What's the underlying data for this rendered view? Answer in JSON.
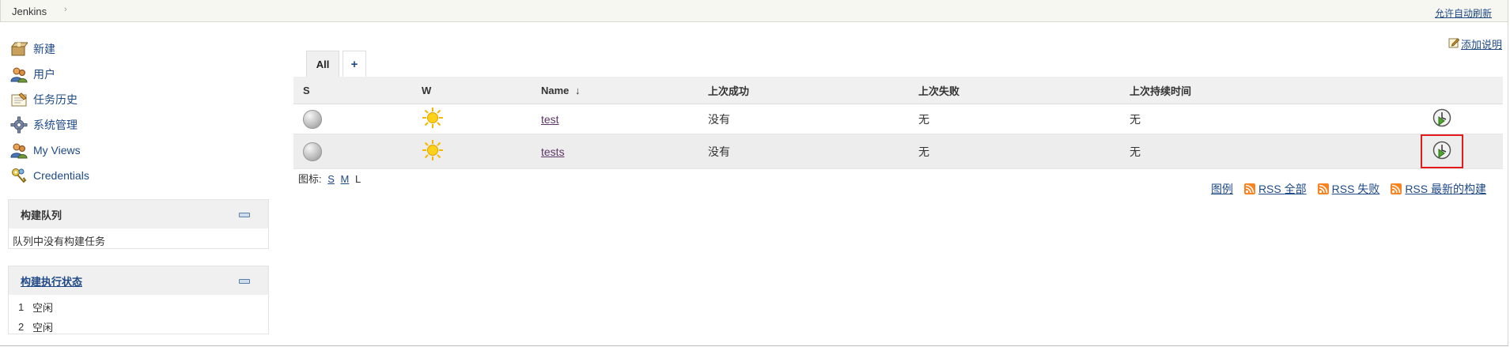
{
  "breadcrumb": {
    "root": "Jenkins",
    "separator": "›",
    "autorefresh": "允许自动刷新"
  },
  "tasks": [
    {
      "label": "新建",
      "icon": "new-item-icon"
    },
    {
      "label": "用户",
      "icon": "people-icon"
    },
    {
      "label": "任务历史",
      "icon": "notepad-icon"
    },
    {
      "label": "系统管理",
      "icon": "gear-icon"
    },
    {
      "label": "My Views",
      "icon": "people-icon"
    },
    {
      "label": "Credentials",
      "icon": "keys-icon"
    }
  ],
  "queue": {
    "title": "构建队列",
    "empty_text": "队列中没有构建任务"
  },
  "executors": {
    "title": "构建执行状态",
    "items": [
      {
        "num": "1",
        "status": "空闲"
      },
      {
        "num": "2",
        "status": "空闲"
      }
    ]
  },
  "main": {
    "add_description": "添加说明",
    "tabs": {
      "all": "All",
      "new": "+"
    },
    "table": {
      "headers": {
        "s": "S",
        "w": "W",
        "name": "Name",
        "sort_arrow": "↓",
        "last_success": "上次成功",
        "last_failure": "上次失败",
        "last_duration": "上次持续时间"
      },
      "rows": [
        {
          "name": "test",
          "last_success": "没有",
          "last_failure": "无",
          "last_duration": "无"
        },
        {
          "name": "tests",
          "last_success": "没有",
          "last_failure": "无",
          "last_duration": "无"
        }
      ]
    },
    "icon_size": {
      "label": "图标:",
      "s": "S",
      "m": "M",
      "l": "L"
    },
    "rss": {
      "legend": "图例",
      "all": "RSS 全部",
      "failed": "RSS 失败",
      "latest": "RSS 最新的构建"
    }
  },
  "colors": {
    "link": "#204a87",
    "visited_link": "#5c3566",
    "highlight": "#e41b1b",
    "rss": "#f78422"
  }
}
